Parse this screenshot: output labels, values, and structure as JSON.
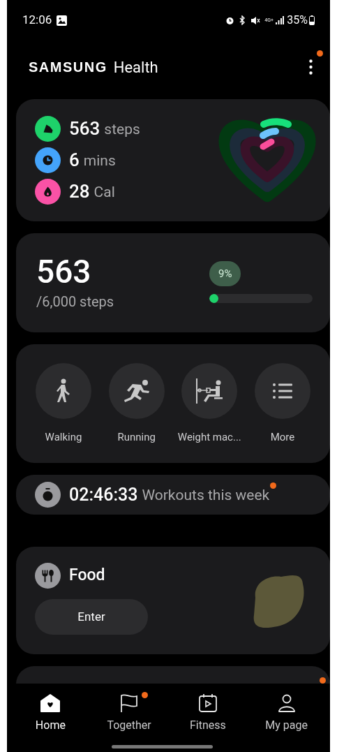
{
  "status_bar": {
    "time": "12:06",
    "network": "4G+",
    "battery": "35%"
  },
  "header": {
    "brand": "SAMSUNG",
    "title": "Health",
    "menu_badge": true
  },
  "activity": {
    "metrics": [
      {
        "kind": "steps",
        "value": "563",
        "unit": "steps",
        "color": "#1ed26a"
      },
      {
        "kind": "time",
        "value": "6",
        "unit": "mins",
        "color": "#44a4fb"
      },
      {
        "kind": "calories",
        "value": "28",
        "unit": "Cal",
        "color": "#fa52a6"
      }
    ]
  },
  "steps": {
    "value": "563",
    "goal": "/6,000 steps",
    "percent": "9%",
    "level": 0.09
  },
  "workouts": [
    {
      "kind": "walking",
      "label": "Walking"
    },
    {
      "kind": "running",
      "label": "Running"
    },
    {
      "kind": "weights",
      "label": "Weight mac..."
    },
    {
      "kind": "more",
      "label": "More"
    }
  ],
  "workout_time": {
    "time": "02:46:33",
    "label": "Workouts this week",
    "badge": true
  },
  "food": {
    "title": "Food",
    "button": "Enter"
  },
  "next_card": {
    "badge": true
  },
  "nav": [
    {
      "kind": "home",
      "label": "Home",
      "selected": true,
      "badge": false
    },
    {
      "kind": "together",
      "label": "Together",
      "selected": false,
      "badge": true
    },
    {
      "kind": "fitness",
      "label": "Fitness",
      "selected": false,
      "badge": false
    },
    {
      "kind": "mypage",
      "label": "My page",
      "selected": false,
      "badge": false
    }
  ]
}
